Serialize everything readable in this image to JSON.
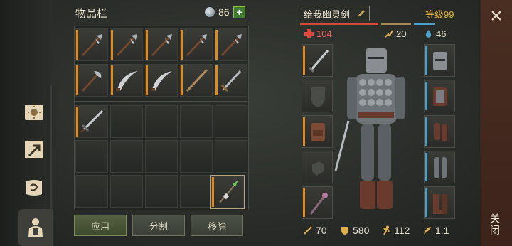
{
  "inventory": {
    "title": "物品栏",
    "currency_count": "86",
    "plus_label": "+"
  },
  "buttons": {
    "apply": "应用",
    "split": "分割",
    "remove": "移除"
  },
  "character": {
    "name": "给我幽灵剑",
    "level": "等级99",
    "health": "104",
    "stamina": "20",
    "water": "46",
    "attack": "70",
    "defense": "580",
    "speed": "112",
    "weight": "1.1"
  },
  "close_label": "关闭",
  "colors": {
    "accent_orange": "#e08a1e",
    "accent_blue": "#4aa0c6",
    "health_red": "#d9473a",
    "level_gold": "#e7b23e"
  },
  "icons": {
    "tabs": [
      "sun-scroll-icon",
      "arrow-map-icon",
      "quest-scroll-icon",
      "character-icon"
    ],
    "stats": [
      "health-cross-icon",
      "stamina-icon",
      "water-drop-icon"
    ],
    "bottom": [
      "sword-icon",
      "shield-icon",
      "run-icon",
      "feather-icon"
    ]
  }
}
